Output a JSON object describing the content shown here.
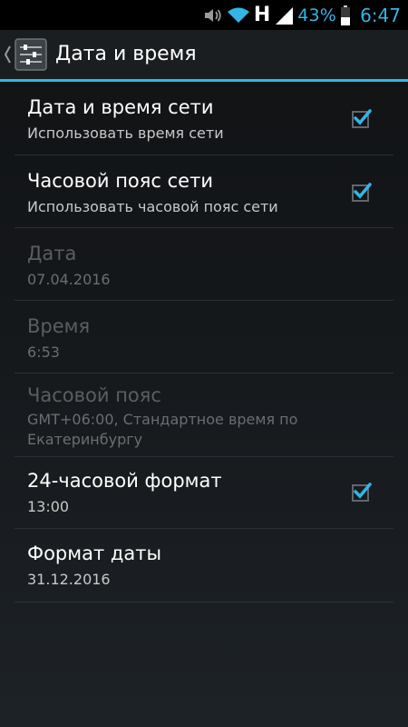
{
  "status_bar": {
    "network_type": "H",
    "battery": "43%",
    "time": "6:47",
    "icons": [
      "volume-icon",
      "wifi-icon",
      "signal-icon",
      "battery-icon"
    ]
  },
  "action_bar": {
    "title": "Дата и время",
    "icon": "settings-sliders-icon"
  },
  "colors": {
    "accent": "#33b5e5",
    "background": "#141618",
    "divider": "#2b3034",
    "disabled_text": "#5a5e61"
  },
  "preferences": [
    {
      "title": "Дата и время сети",
      "summary": "Использовать время сети",
      "checked": true,
      "enabled": true
    },
    {
      "title": "Часовой пояс сети",
      "summary": "Использовать часовой пояс сети",
      "checked": true,
      "enabled": true
    },
    {
      "title": "Дата",
      "summary": "07.04.2016",
      "enabled": false
    },
    {
      "title": "Время",
      "summary": "6:53",
      "enabled": false
    },
    {
      "title": "Часовой пояс",
      "summary": "GMT+06:00, Стандартное время по Екатеринбургу",
      "enabled": false
    },
    {
      "title": "24-часовой формат",
      "summary": "13:00",
      "checked": true,
      "enabled": true
    },
    {
      "title": "Формат даты",
      "summary": "31.12.2016",
      "enabled": true
    }
  ]
}
